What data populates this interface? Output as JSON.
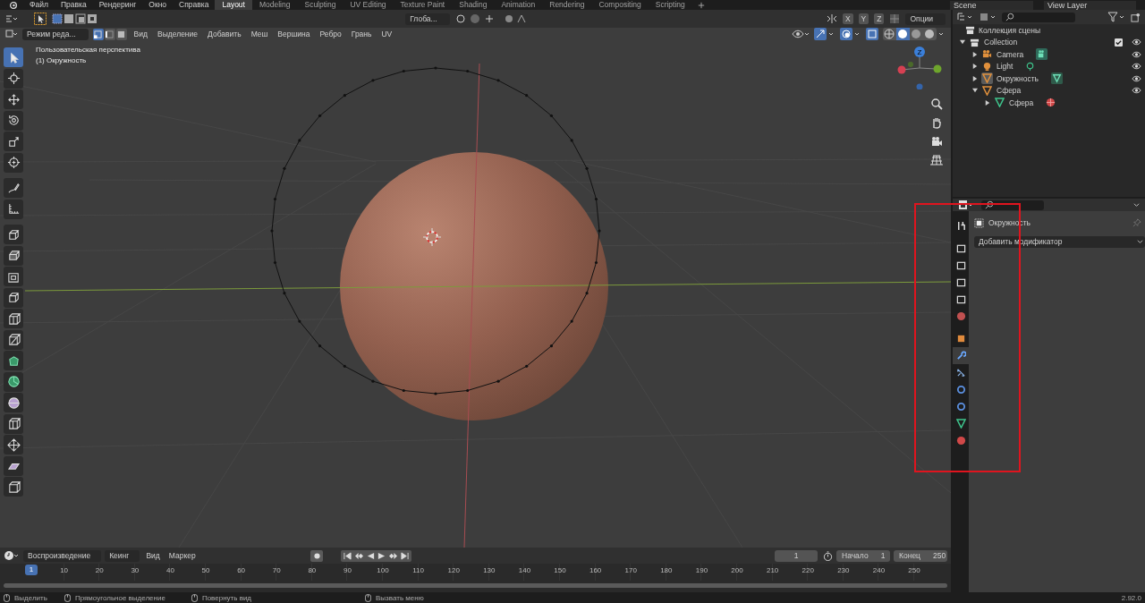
{
  "menubar": {
    "menus": [
      "Файл",
      "Правка",
      "Рендеринг",
      "Окно",
      "Справка"
    ],
    "workspaces": [
      {
        "label": "Layout",
        "selected": true
      },
      {
        "label": "Modeling",
        "selected": false
      },
      {
        "label": "Sculpting",
        "selected": false
      },
      {
        "label": "UV Editing",
        "selected": false
      },
      {
        "label": "Texture Paint",
        "selected": false
      },
      {
        "label": "Shading",
        "selected": false
      },
      {
        "label": "Animation",
        "selected": false
      },
      {
        "label": "Rendering",
        "selected": false
      },
      {
        "label": "Compositing",
        "selected": false
      },
      {
        "label": "Scripting",
        "selected": false
      }
    ],
    "scene": "Scene",
    "view_layer": "View Layer"
  },
  "tool_header": {
    "transform_orientation": "Глоба...",
    "mirror_axes": [
      "X",
      "Y",
      "Z"
    ],
    "options": "Опции"
  },
  "viewport_header": {
    "mode": "Режим реда...",
    "select_modes": [
      {
        "kind": "vertex",
        "selected": true
      },
      {
        "kind": "edge",
        "selected": false
      },
      {
        "kind": "face",
        "selected": false
      }
    ],
    "menus": [
      "Вид",
      "Выделение",
      "Добавить",
      "Меш",
      "Вершина",
      "Ребро",
      "Грань",
      "UV"
    ]
  },
  "viewport": {
    "view_name": "Пользовательская перспектива",
    "object_label": "(1) Окружность",
    "gizmo_label": "Z",
    "tools": [
      {
        "kind": "select",
        "selected": true
      },
      {
        "kind": "cursor",
        "selected": false
      },
      {
        "kind": "move",
        "selected": false
      },
      {
        "kind": "rotate",
        "selected": false
      },
      {
        "kind": "scale",
        "selected": false
      },
      {
        "kind": "transform",
        "selected": false
      },
      {
        "kind": "annotate",
        "selected": false
      },
      {
        "kind": "measure",
        "selected": false
      },
      {
        "kind": "add-cube",
        "selected": false
      },
      {
        "kind": "extrude",
        "selected": false
      },
      {
        "kind": "inset",
        "selected": false
      },
      {
        "kind": "bevel",
        "selected": false
      },
      {
        "kind": "loop-cut",
        "selected": false
      },
      {
        "kind": "knife",
        "selected": false
      },
      {
        "kind": "poly-build",
        "selected": false
      },
      {
        "kind": "spin",
        "selected": false
      },
      {
        "kind": "smooth",
        "selected": false
      },
      {
        "kind": "edge-slide",
        "selected": false
      },
      {
        "kind": "shrink",
        "selected": false
      },
      {
        "kind": "shear",
        "selected": false
      },
      {
        "kind": "rip",
        "selected": false
      }
    ]
  },
  "outliner": {
    "title": "Коллекция сцены",
    "items": [
      {
        "label": "Collection",
        "kind": "collection",
        "expanded": true,
        "selected": false,
        "checked": true,
        "visible": true,
        "children": [
          {
            "label": "Camera",
            "kind": "camera",
            "badge": {
              "kind": "camera-data"
            },
            "expanded": false,
            "selected": false,
            "visible": true
          },
          {
            "label": "Light",
            "kind": "light",
            "badge": {
              "kind": "light-data"
            },
            "expanded": false,
            "selected": false,
            "visible": true
          },
          {
            "label": "Окружность",
            "kind": "mesh",
            "badge": {
              "kind": "mesh-data"
            },
            "expanded": false,
            "selected": true,
            "visible": true
          },
          {
            "label": "Сфера",
            "kind": "mesh",
            "expanded": true,
            "selected": false,
            "visible": true,
            "children": [
              {
                "label": "Сфера",
                "kind": "mesh-data",
                "badge": {
                  "kind": "material"
                },
                "expanded": false,
                "selected": false
              }
            ]
          }
        ]
      }
    ]
  },
  "properties": {
    "object_name": "Окружность",
    "add_modifier": "Добавить модификатор",
    "tabs": [
      {
        "kind": "tool",
        "selected": false
      },
      {
        "kind": "render",
        "selected": false
      },
      {
        "kind": "output",
        "selected": false
      },
      {
        "kind": "view-layer",
        "selected": false
      },
      {
        "kind": "scene",
        "selected": false
      },
      {
        "kind": "world",
        "selected": false
      },
      {
        "kind": "object",
        "selected": false
      },
      {
        "kind": "modifier",
        "selected": true
      },
      {
        "kind": "particles",
        "selected": false
      },
      {
        "kind": "physics",
        "selected": false
      },
      {
        "kind": "constraints",
        "selected": false
      },
      {
        "kind": "data",
        "selected": false
      },
      {
        "kind": "material",
        "selected": false
      }
    ]
  },
  "timeline": {
    "menus": [
      "Воспроизведение",
      "Кеинг",
      "Вид",
      "Маркер"
    ],
    "current_frame": "1",
    "start_label": "Начало",
    "start": "1",
    "end_label": "Конец",
    "end": "250",
    "playhead": "1",
    "frames": [
      "10",
      "20",
      "30",
      "40",
      "50",
      "60",
      "70",
      "80",
      "90",
      "100",
      "110",
      "120",
      "130",
      "140",
      "150",
      "160",
      "170",
      "180",
      "190",
      "200",
      "210",
      "220",
      "230",
      "240",
      "250"
    ]
  },
  "status_bar": {
    "hints": [
      "Выделить",
      "Прямоугольное выделение",
      "Повернуть вид",
      "Вызвать меню"
    ],
    "version": "2.92.0"
  }
}
